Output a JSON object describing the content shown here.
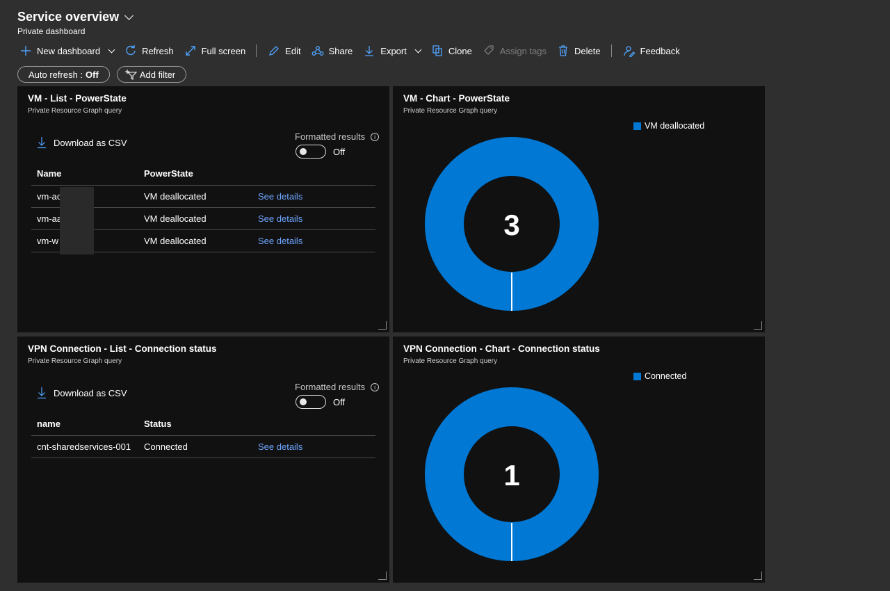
{
  "header": {
    "title": "Service overview",
    "subtitle": "Private dashboard"
  },
  "toolbar": {
    "new_dashboard": "New dashboard",
    "refresh": "Refresh",
    "full_screen": "Full screen",
    "edit": "Edit",
    "share": "Share",
    "export": "Export",
    "clone": "Clone",
    "assign_tags": "Assign tags",
    "delete": "Delete",
    "feedback": "Feedback"
  },
  "filters": {
    "auto_refresh_label": "Auto refresh :",
    "auto_refresh_value": "Off",
    "add_filter": "Add filter"
  },
  "colors": {
    "accent": "#0078d4",
    "link": "#6ea6ff",
    "tile_bg": "#111111",
    "page_bg": "#2f2f2f"
  },
  "tiles": {
    "vm_list": {
      "title": "VM - List - PowerState",
      "subtitle": "Private Resource Graph query",
      "download": "Download as CSV",
      "formatted": "Formatted results",
      "toggle": "Off",
      "columns": [
        "Name",
        "PowerState"
      ],
      "rows": [
        {
          "name": "vm-ac",
          "state": "VM deallocated",
          "link": "See details"
        },
        {
          "name": "vm-aa",
          "state": "VM deallocated",
          "link": "See details"
        },
        {
          "name": "vm-w",
          "state": "VM deallocated",
          "link": "See details"
        }
      ]
    },
    "vm_chart": {
      "title": "VM - Chart - PowerState",
      "subtitle": "Private Resource Graph query",
      "legend": "VM deallocated",
      "total": "3"
    },
    "vpn_list": {
      "title": "VPN Connection - List - Connection status",
      "subtitle": "Private Resource Graph query",
      "download": "Download as CSV",
      "formatted": "Formatted results",
      "toggle": "Off",
      "columns": [
        "name",
        "Status"
      ],
      "rows": [
        {
          "name": "cnt-sharedservices-001",
          "state": "Connected",
          "link": "See details"
        }
      ]
    },
    "vpn_chart": {
      "title": "VPN Connection - Chart - Connection status",
      "subtitle": "Private Resource Graph query",
      "legend": "Connected",
      "total": "1"
    }
  },
  "chart_data": [
    {
      "type": "pie",
      "donut": true,
      "categories": [
        "VM deallocated"
      ],
      "values": [
        3
      ],
      "center_label": "3",
      "legend_position": "top-right"
    },
    {
      "type": "pie",
      "donut": true,
      "categories": [
        "Connected"
      ],
      "values": [
        1
      ],
      "center_label": "1",
      "legend_position": "top-right"
    }
  ]
}
